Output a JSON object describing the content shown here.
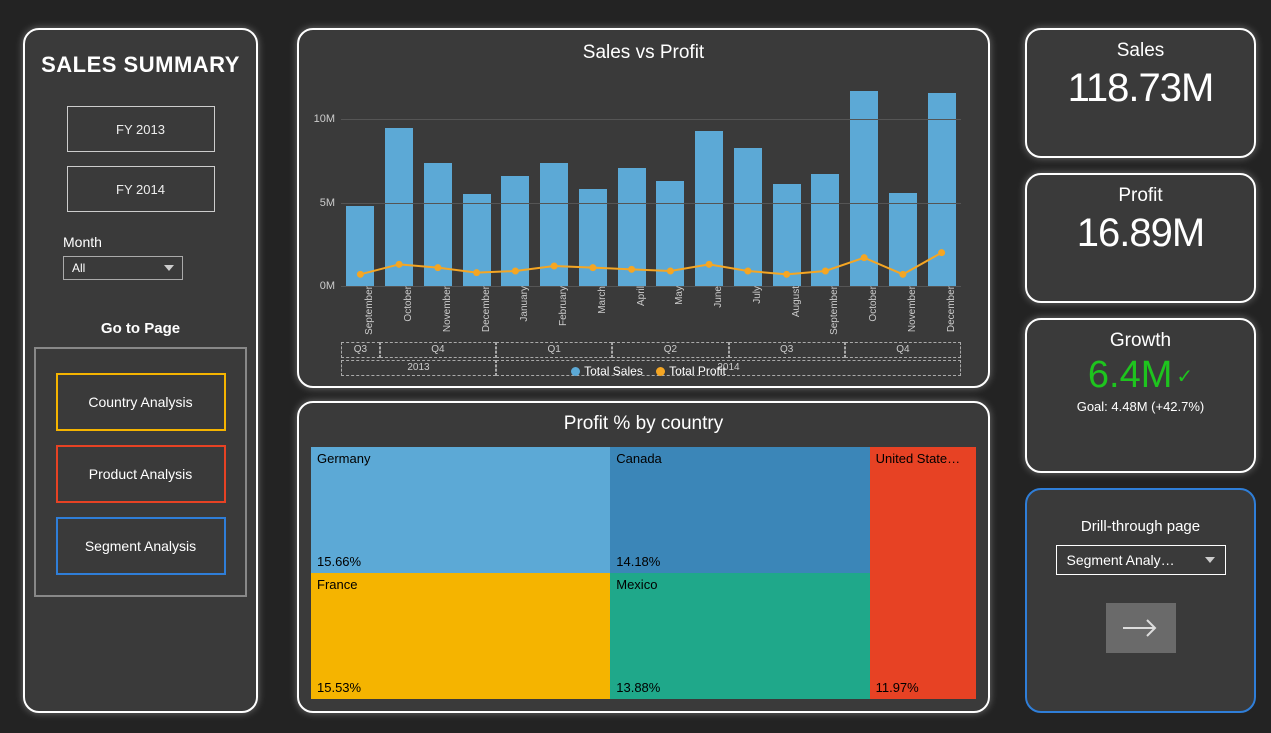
{
  "sidebar": {
    "title": "SALES SUMMARY",
    "fy_buttons": [
      "FY 2013",
      "FY 2014"
    ],
    "month_label": "Month",
    "month_value": "All",
    "goto_label": "Go to Page",
    "nav": [
      "Country Analysis",
      "Product Analysis",
      "Segment Analysis"
    ]
  },
  "kpi": {
    "sales": {
      "label": "Sales",
      "value": "118.73M"
    },
    "profit": {
      "label": "Profit",
      "value": "16.89M"
    },
    "growth": {
      "label": "Growth",
      "value": "6.4M",
      "goal": "Goal: 4.48M (+42.7%)"
    }
  },
  "drill": {
    "label": "Drill-through page",
    "value": "Segment Analy…"
  },
  "chart_data": [
    {
      "type": "bar+line",
      "title": "Sales vs Profit",
      "ylabel": "",
      "xlabel": "",
      "ylim": [
        0,
        12000000
      ],
      "yticks": [
        0,
        5000000,
        10000000
      ],
      "ytick_labels": [
        "0M",
        "5M",
        "10M"
      ],
      "categories": [
        "September",
        "October",
        "November",
        "December",
        "January",
        "February",
        "March",
        "April",
        "May",
        "June",
        "July",
        "August",
        "September",
        "October",
        "November",
        "December"
      ],
      "hierarchy": {
        "quarters": [
          {
            "label": "Q3",
            "span": [
              0,
              0
            ]
          },
          {
            "label": "Q4",
            "span": [
              1,
              3
            ]
          },
          {
            "label": "Q1",
            "span": [
              4,
              6
            ]
          },
          {
            "label": "Q2",
            "span": [
              7,
              9
            ]
          },
          {
            "label": "Q3",
            "span": [
              10,
              12
            ]
          },
          {
            "label": "Q4",
            "span": [
              13,
              15
            ]
          }
        ],
        "years": [
          {
            "label": "2013",
            "span": [
              0,
              3
            ]
          },
          {
            "label": "2014",
            "span": [
              4,
              15
            ]
          }
        ]
      },
      "series": [
        {
          "name": "Total Sales",
          "type": "bar",
          "color": "#5ca9d6",
          "values": [
            4800000,
            9500000,
            7400000,
            5500000,
            6600000,
            7400000,
            5800000,
            7100000,
            6300000,
            9300000,
            8300000,
            6100000,
            6700000,
            11700000,
            5600000,
            11600000
          ]
        },
        {
          "name": "Total Profit",
          "type": "line",
          "color": "#f5a623",
          "values": [
            700000,
            1300000,
            1100000,
            800000,
            900000,
            1200000,
            1100000,
            1000000,
            900000,
            1300000,
            900000,
            700000,
            900000,
            1700000,
            700000,
            2000000
          ]
        }
      ],
      "legend": [
        "Total Sales",
        "Total Profit"
      ]
    },
    {
      "type": "treemap",
      "title": "Profit % by country",
      "items": [
        {
          "name": "Germany",
          "value": 15.66,
          "label": "15.66%",
          "color": "#5ca9d6"
        },
        {
          "name": "France",
          "value": 15.53,
          "label": "15.53%",
          "color": "#f5b400"
        },
        {
          "name": "Canada",
          "value": 14.18,
          "label": "14.18%",
          "color": "#3b86b8"
        },
        {
          "name": "Mexico",
          "value": 13.88,
          "label": "13.88%",
          "color": "#1fa88a"
        },
        {
          "name": "United State…",
          "value": 11.97,
          "label": "11.97%",
          "color": "#e74224"
        }
      ]
    }
  ]
}
